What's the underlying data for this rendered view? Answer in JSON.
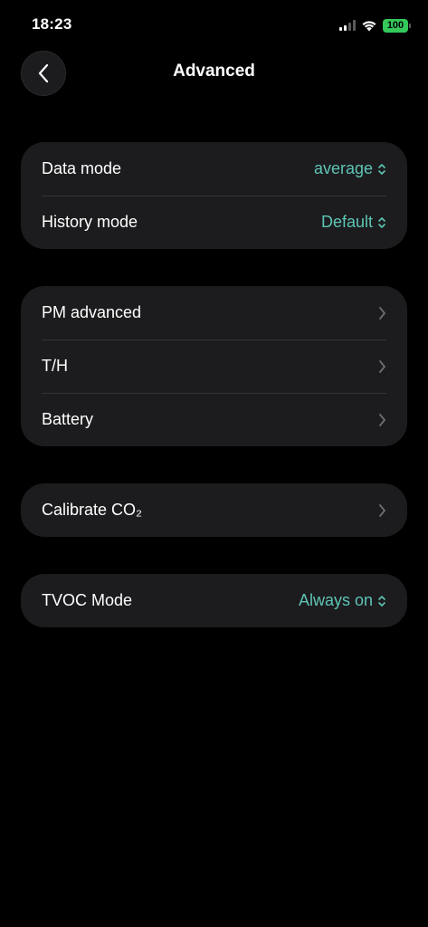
{
  "status_bar": {
    "time": "18:23",
    "battery_level": "100",
    "icons": [
      "cellular-signal-icon",
      "wifi-icon",
      "battery-icon"
    ]
  },
  "nav": {
    "title": "Advanced",
    "back_icon": "chevron-left-icon"
  },
  "groups": {
    "display": {
      "data_mode": {
        "label": "Data mode",
        "value": "average"
      },
      "history_mode": {
        "label": "History mode",
        "value": "Default"
      }
    },
    "sensors": {
      "pm_advanced": {
        "label": "PM advanced"
      },
      "th": {
        "label": "T/H"
      },
      "battery": {
        "label": "Battery"
      }
    },
    "calibration": {
      "calibrate_co2": {
        "label": "Calibrate CO₂"
      }
    },
    "tvoc": {
      "tvoc_mode": {
        "label": "TVOC Mode",
        "value": "Always on"
      }
    }
  },
  "colors": {
    "background": "#000000",
    "card": "#1c1c1e",
    "accent": "#5ec4b6",
    "chevron": "#6d6d72",
    "battery": "#34c759"
  }
}
